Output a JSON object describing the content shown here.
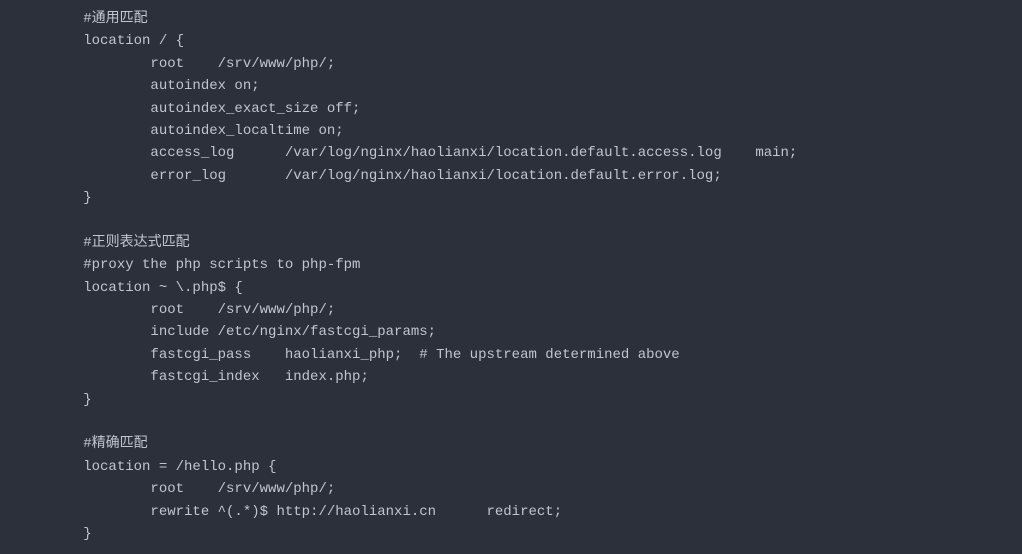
{
  "code_lines": [
    "        #通用匹配",
    "        location / {",
    "                root    /srv/www/php/;",
    "                autoindex on;",
    "                autoindex_exact_size off;",
    "                autoindex_localtime on;",
    "                access_log      /var/log/nginx/haolianxi/location.default.access.log    main;",
    "                error_log       /var/log/nginx/haolianxi/location.default.error.log;",
    "        }",
    "",
    "        #正则表达式匹配",
    "        #proxy the php scripts to php-fpm",
    "        location ~ \\.php$ {",
    "                root    /srv/www/php/;",
    "                include /etc/nginx/fastcgi_params;",
    "                fastcgi_pass    haolianxi_php;  # The upstream determined above",
    "                fastcgi_index   index.php;",
    "        }",
    "",
    "        #精确匹配",
    "        location = /hello.php {",
    "                root    /srv/www/php/;",
    "                rewrite ^(.*)$ http://haolianxi.cn      redirect;",
    "        }"
  ]
}
